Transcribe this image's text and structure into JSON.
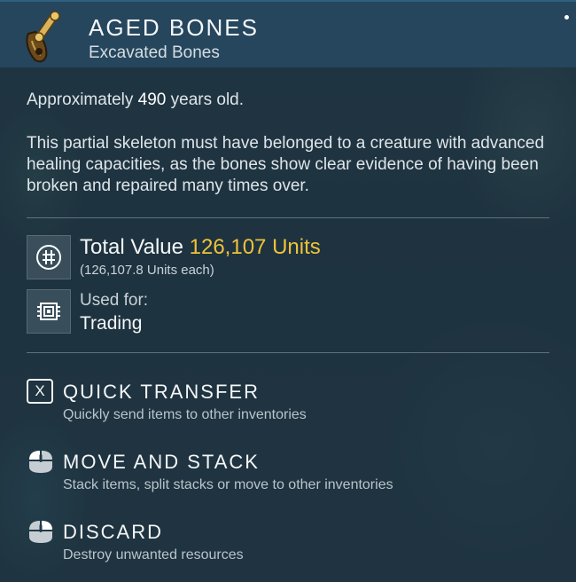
{
  "item": {
    "name": "AGED BONES",
    "category": "Excavated Bones",
    "age_prefix": "Approximately",
    "age_value": "490",
    "age_suffix": "years old.",
    "description": "This partial skeleton must have belonged to a creature with advanced healing capacities, as the bones show clear evidence of having been broken and repaired many times over.",
    "icon": "bone-artifact-icon"
  },
  "value": {
    "label": "Total Value",
    "amount": "126,107 Units",
    "each": "(126,107.8 Units each)",
    "icon": "units-currency-icon",
    "amount_color": "#f0c23a"
  },
  "usage": {
    "label": "Used for:",
    "value": "Trading",
    "icon": "trade-chip-icon"
  },
  "actions": [
    {
      "key": "X",
      "title": "QUICK TRANSFER",
      "description": "Quickly send items to other inventories",
      "icon": "x-key-icon"
    },
    {
      "title": "MOVE AND STACK",
      "description": "Stack items, split stacks or move to other inventories",
      "icon": "mouse-left-click-icon"
    },
    {
      "title": "DISCARD",
      "description": "Destroy unwanted resources",
      "icon": "mouse-right-click-icon"
    }
  ]
}
